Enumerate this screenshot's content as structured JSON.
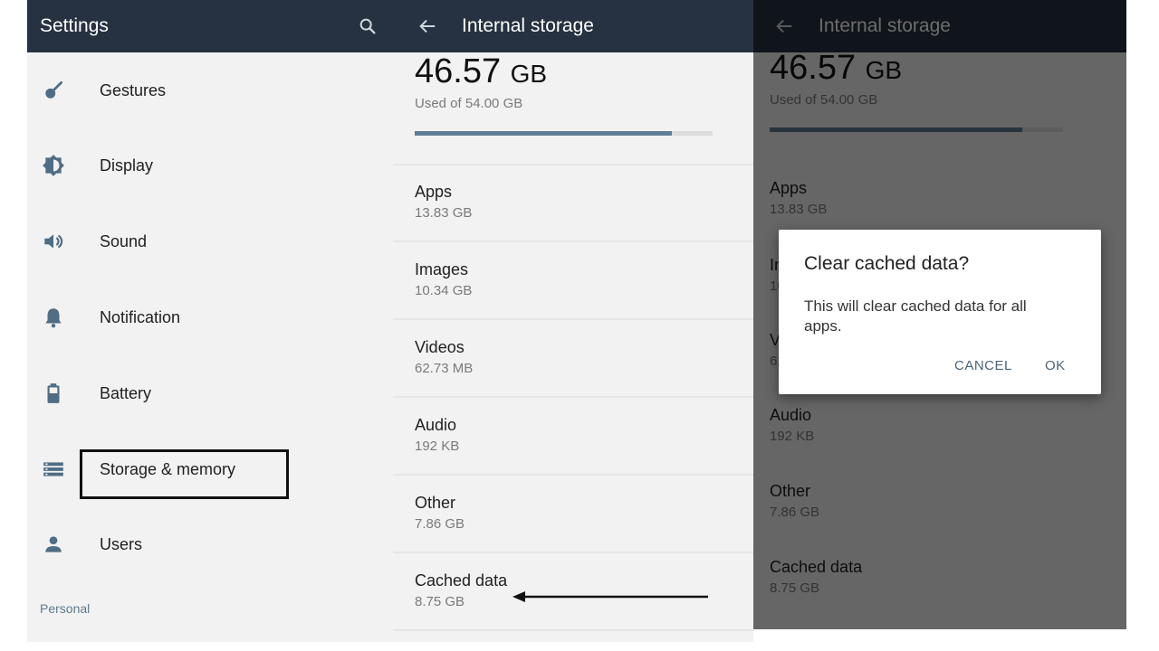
{
  "settings": {
    "title": "Settings",
    "items": [
      {
        "label": "Gestures",
        "icon": "gestures-icon"
      },
      {
        "label": "Display",
        "icon": "brightness-icon"
      },
      {
        "label": "Sound",
        "icon": "volume-icon"
      },
      {
        "label": "Notification",
        "icon": "bell-icon"
      },
      {
        "label": "Battery",
        "icon": "battery-icon"
      },
      {
        "label": "Storage & memory",
        "icon": "storage-icon"
      },
      {
        "label": "Users",
        "icon": "person-icon"
      }
    ],
    "section_personal": "Personal"
  },
  "storage": {
    "title": "Internal storage",
    "used_value": "46.57",
    "used_unit": "GB",
    "used_of": "Used of 54.00 GB",
    "used_fraction": 0.862,
    "items": [
      {
        "name": "Apps",
        "size": "13.83 GB"
      },
      {
        "name": "Images",
        "size": "10.34 GB"
      },
      {
        "name": "Videos",
        "size": "62.73 MB"
      },
      {
        "name": "Audio",
        "size": "192 KB"
      },
      {
        "name": "Other",
        "size": "7.86 GB"
      },
      {
        "name": "Cached data",
        "size": "8.75 GB"
      }
    ]
  },
  "dialog": {
    "title": "Clear cached data?",
    "message": "This will clear cached data for all apps.",
    "cancel": "CANCEL",
    "ok": "OK"
  },
  "colors": {
    "appbar": "#263241",
    "icon": "#4f6d84",
    "progress": "#607d98",
    "accent_button": "#4a6478"
  }
}
